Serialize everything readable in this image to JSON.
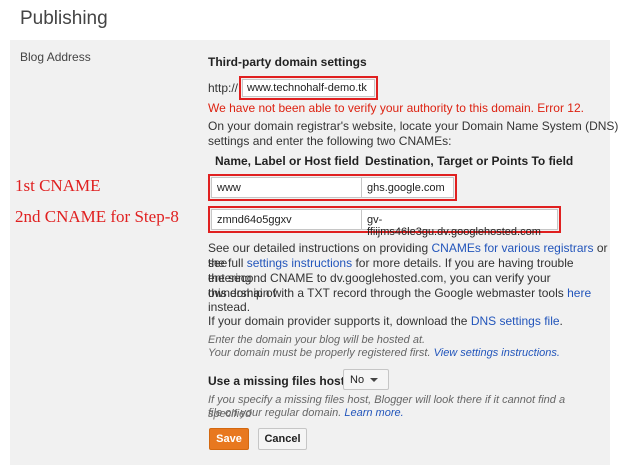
{
  "header": {
    "title": "Publishing"
  },
  "sidebar": {
    "blog_address_label": "Blog Address"
  },
  "domain": {
    "section_title": "Third-party domain settings",
    "prefix": "http://",
    "value": "www.technohalf-demo.tk",
    "error": "We have not been able to verify your authority to this domain. Error 12.",
    "instructions_line1": "On your domain registrar's website, locate your Domain Name System (DNS)",
    "instructions_line2": "settings and enter the following two CNAMEs:",
    "col_header_name": "Name, Label or Host field",
    "col_header_dest": "Destination, Target or Points To field"
  },
  "cnames": [
    {
      "annotation": "1st CNAME",
      "name": "www",
      "destination": "ghs.google.com"
    },
    {
      "annotation": "2nd CNAME for Step-8",
      "name": "zmnd64o5ggxv",
      "destination": "gv-ffiijms46le3gu.dv.googlehosted.com"
    }
  ],
  "help": {
    "p1_a": "See our detailed instructions on providing",
    "p1_link": "CNAMEs for various registrars",
    "p1_b": "or see",
    "p2_a": "the full",
    "p2_link": "settings instructions",
    "p2_b": "for more details. If you are having trouble entering",
    "p3": "the second CNAME to dv.googlehosted.com, you can verify your ownership of",
    "p4_a": "this domain with a TXT record through the Google webmaster tools",
    "p4_link": "here",
    "p5": "instead.",
    "p6_a": "If your domain provider supports it, download the",
    "p6_link": "DNS settings file",
    "p6_b": "."
  },
  "hosted": {
    "line1": "Enter the domain your blog will be hosted at.",
    "line2": "Your domain must be properly registered first.",
    "link": "View settings instructions."
  },
  "missing_host": {
    "label": "Use a missing files host?",
    "selected": "No",
    "desc1": "If you specify a missing files host, Blogger will look there if it cannot find a specified",
    "desc2": "file on your regular domain.",
    "link": "Learn more."
  },
  "actions": {
    "save": "Save",
    "cancel": "Cancel"
  },
  "colors": {
    "accent": "#e8781f",
    "error": "#dd2211",
    "link": "#2255bb",
    "highlight": "#e02020"
  }
}
